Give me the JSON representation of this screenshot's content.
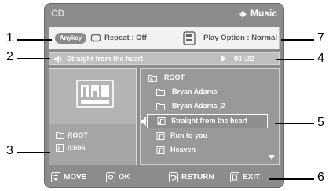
{
  "header": {
    "source": "CD",
    "mode": "Music"
  },
  "status": {
    "anykey": "Anykey",
    "repeat": "Repeat : Off",
    "play_option": "Play Option : Normal"
  },
  "track": {
    "title": "Straight from the heart",
    "time": "00 :22"
  },
  "left_panel": {
    "logo": "mp3",
    "folder": "ROOT",
    "count": "03/06"
  },
  "list": {
    "items": [
      {
        "type": "folder-up",
        "label": "ROOT"
      },
      {
        "type": "folder",
        "label": "Bryan Adams"
      },
      {
        "type": "folder",
        "label": "Bryan Adams_2"
      },
      {
        "type": "file",
        "label": "Straight from the heart",
        "selected": true
      },
      {
        "type": "file",
        "label": "Run to you"
      },
      {
        "type": "file",
        "label": "Heaven"
      }
    ]
  },
  "footer": {
    "move": "MOVE",
    "ok": "OK",
    "return": "RETURN",
    "exit": "EXIT"
  },
  "callouts": [
    "1",
    "2",
    "3",
    "4",
    "5",
    "6",
    "7"
  ]
}
